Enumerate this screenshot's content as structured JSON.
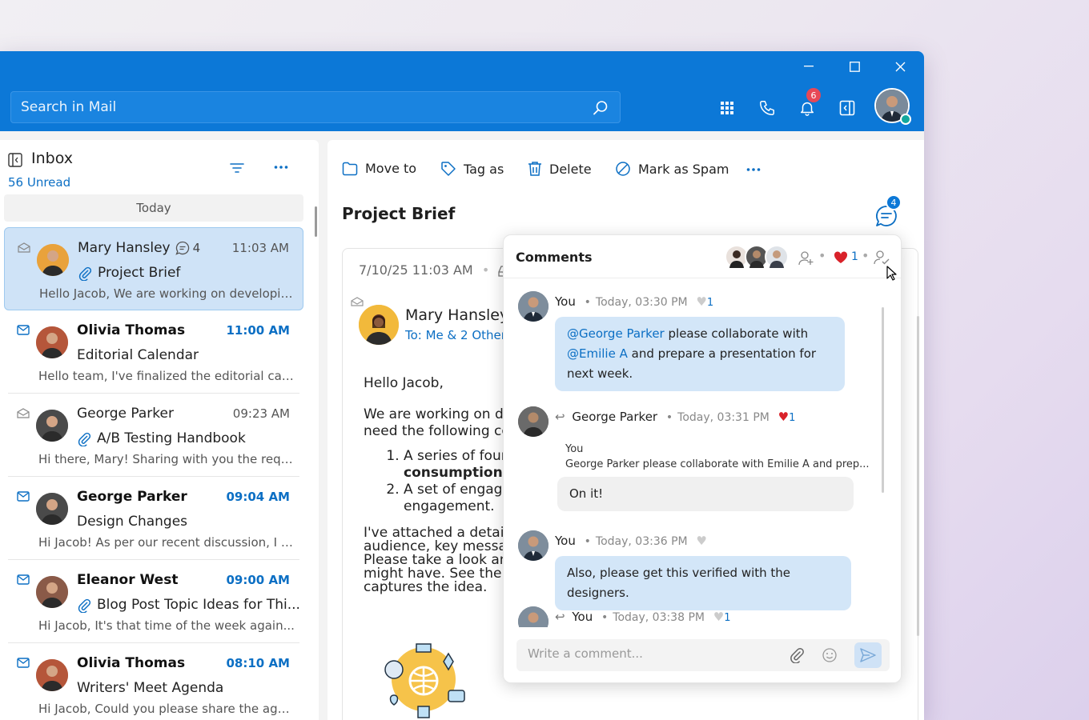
{
  "app": {
    "search_placeholder": "Search in Mail",
    "notification_count": "6"
  },
  "inbox": {
    "title": "Inbox",
    "unread": "56 Unread",
    "group_label": "Today",
    "mails": [
      {
        "sender": "Mary Hansley",
        "comment_count": "4",
        "time": "11:03 AM",
        "subject": "Project Brief",
        "preview": "Hello Jacob, We are working on developin...",
        "unread": false,
        "selected": true,
        "attachment": true,
        "avatar_color": "#e9a23b"
      },
      {
        "sender": "Olivia Thomas",
        "time": "11:00 AM",
        "subject": "Editorial Calendar",
        "preview": "Hello team, I've finalized the editorial cale...",
        "unread": true,
        "attachment": false,
        "avatar_color": "#b5563a"
      },
      {
        "sender": "George Parker",
        "time": "09:23 AM",
        "subject": "A/B Testing Handbook",
        "preview": "Hi there, Mary! Sharing with you the requ...",
        "unread": false,
        "attachment": true,
        "avatar_color": "#4a4a4a"
      },
      {
        "sender": "George Parker",
        "time": "09:04 AM",
        "subject": "Design Changes",
        "preview": "Hi Jacob! As per our recent discussion, I a...",
        "unread": true,
        "attachment": false,
        "avatar_color": "#4a4a4a"
      },
      {
        "sender": "Eleanor West",
        "time": "09:00 AM",
        "subject": "Blog Post Topic Ideas for Thi...",
        "preview": "Hi Jacob, It's that time of the week again...",
        "unread": true,
        "attachment": true,
        "avatar_color": "#8a5a48"
      },
      {
        "sender": "Olivia Thomas",
        "time": "08:10 AM",
        "subject": "Writers' Meet Agenda",
        "preview": "Hi Jacob, Could you please share the agen...",
        "unread": true,
        "attachment": false,
        "avatar_color": "#b5563a"
      }
    ]
  },
  "toolbar": {
    "move_to": "Move to",
    "tag_as": "Tag as",
    "delete": "Delete",
    "mark_spam": "Mark as Spam"
  },
  "message": {
    "subject": "Project Brief",
    "comments_count": "4",
    "date": "7/10/25 11:03 AM",
    "from": "Mary Hansley",
    "to": "To: Me & 2 Others",
    "greeting": "Hello Jacob,",
    "para1": "We are working on developing a marketing campaign and need the following content:",
    "item1_a": "A series of four",
    "item1_b": "consumption",
    "item2": "A set of engaging posts to drive engagement.",
    "para2": "I've attached a detailed brief with the target audience, key messages for each piece. Please take a look and share suggestions you might have. See the image below that captures the idea."
  },
  "comments": {
    "title": "Comments",
    "like_count": "1",
    "items": [
      {
        "author": "You",
        "time": "Today, 03:30 PM",
        "likes": "1",
        "mention1": "@George Parker",
        "text1": " please collaborate with ",
        "mention2": "@Emilie A",
        "text2": " and prepare a presentation for next week."
      },
      {
        "author": "George Parker",
        "time": "Today, 03:31 PM",
        "likes": "1",
        "quote_author": "You",
        "quote_text": "George Parker please collaborate with Emilie A and prep...",
        "text": "On it!"
      },
      {
        "author": "You",
        "time": "Today, 03:36 PM",
        "text": "Also, please get this verified with the designers."
      },
      {
        "author": "You",
        "time": "Today, 03:38 PM",
        "likes": "1"
      }
    ],
    "input_placeholder": "Write a comment..."
  }
}
